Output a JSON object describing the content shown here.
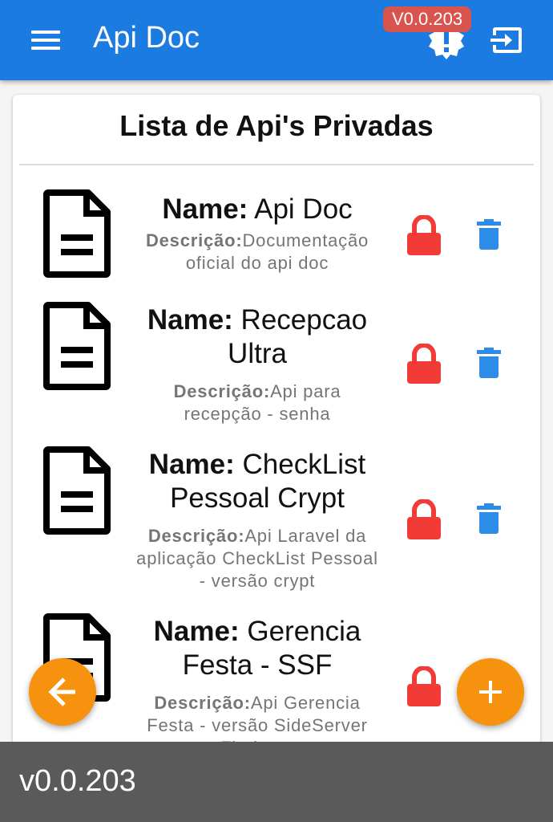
{
  "appbar": {
    "title": "Api Doc",
    "version_badge": "V0.0.203",
    "color": "#1c7be0",
    "icons": [
      "menu-icon",
      "alert-icon",
      "logout-icon"
    ]
  },
  "card": {
    "title": "Lista de Api's Privadas"
  },
  "labels": {
    "name": "Name:",
    "description": "Descrição:"
  },
  "apis": [
    {
      "name": "Api Doc",
      "description": "Documentação oficial do api doc",
      "locked": true,
      "deletable": true
    },
    {
      "name": "Recepcao Ultra",
      "description": "Api para recepção - senha",
      "locked": true,
      "deletable": true
    },
    {
      "name": "CheckList Pessoal Crypt",
      "description": "Api Laravel da aplicação CheckList Pessoal - versão crypt",
      "locked": true,
      "deletable": true
    },
    {
      "name": "Gerencia Festa - SSF",
      "description": "Api Gerencia Festa - versão SideServer Firebase",
      "locked": true,
      "deletable": false
    }
  ],
  "colors": {
    "lock": "#f23a37",
    "trash": "#2d8ce8",
    "fab": "#f7920e",
    "footer": "#5a5a5a"
  },
  "fabs": [
    "back-arrow-icon",
    "plus-icon"
  ],
  "footer": {
    "version": "v0.0.203"
  }
}
